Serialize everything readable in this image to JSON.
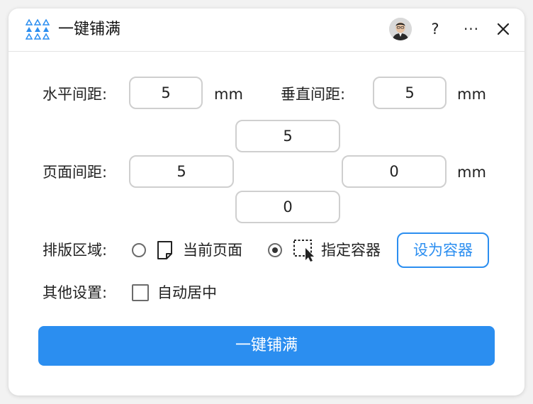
{
  "titlebar": {
    "title": "一键铺满",
    "help_label": "?",
    "more_label": "···",
    "icons": {
      "app": "triangle-grid-icon",
      "avatar": "user-avatar",
      "close": "close-icon"
    }
  },
  "spacing": {
    "horizontal_label": "水平间距:",
    "horizontal_value": "5",
    "horizontal_unit": "mm",
    "vertical_label": "垂直间距:",
    "vertical_value": "5",
    "vertical_unit": "mm"
  },
  "margin": {
    "label": "页面间距:",
    "top": "5",
    "left": "5",
    "right": "0",
    "bottom": "0",
    "unit": "mm"
  },
  "layout_area": {
    "label": "排版区域:",
    "options": [
      {
        "label": "当前页面",
        "checked": false,
        "icon": "page-icon"
      },
      {
        "label": "指定容器",
        "checked": true,
        "icon": "dashed-select-cursor-icon"
      }
    ],
    "set_container_label": "设为容器"
  },
  "other": {
    "label": "其他设置:",
    "auto_center_label": "自动居中",
    "auto_center_checked": false
  },
  "primary_action_label": "一键铺满",
  "colors": {
    "accent": "#2b8ef0",
    "border": "#cfcfcf"
  }
}
